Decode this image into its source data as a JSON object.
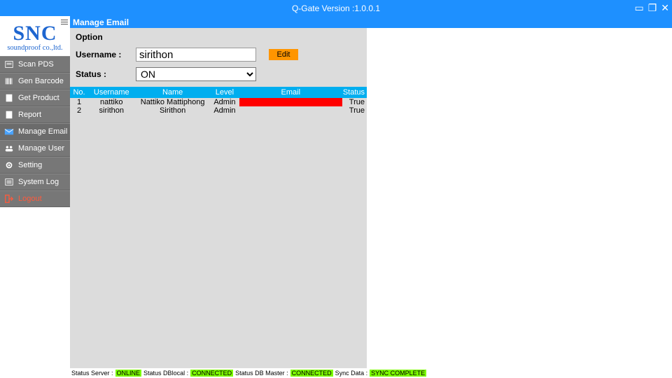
{
  "titlebar": {
    "title": "Q-Gate Version :1.0.0.1"
  },
  "brand": {
    "name": "SNC",
    "sub": "soundproof co.,ltd."
  },
  "sidebar": {
    "items": [
      {
        "label": "Scan PDS"
      },
      {
        "label": "Gen Barcode"
      },
      {
        "label": "Get Product"
      },
      {
        "label": "Report"
      },
      {
        "label": "Manage Email"
      },
      {
        "label": "Manage User"
      },
      {
        "label": "Setting"
      },
      {
        "label": "System Log"
      },
      {
        "label": "Logout"
      }
    ]
  },
  "page": {
    "title": "Manage Email"
  },
  "form": {
    "option_label": "Option",
    "username_label": "Username  :",
    "username_value": "sirithon",
    "status_label": "Status  :",
    "status_value": "ON",
    "edit_label": "Edit"
  },
  "table": {
    "headers": {
      "no": "No.",
      "username": "Username",
      "name": "Name",
      "level": "Level",
      "email": "Email",
      "status": "Status"
    },
    "rows": [
      {
        "no": "1",
        "username": "nattiko",
        "name": "Nattiko Mattiphong",
        "level": "Admin",
        "email": "(redacted)",
        "status": "True",
        "redacted": true
      },
      {
        "no": "2",
        "username": "sirithon",
        "name": "Sirithon",
        "level": "Admin",
        "email": "",
        "status": "True",
        "redacted": false
      }
    ]
  },
  "statusbar": {
    "server_label": "Status Server :",
    "server_value": "ONLINE",
    "dblocal_label": "Status DBlocal :",
    "dblocal_value": "CONNECTED",
    "dbmaster_label": "Status DB Master :",
    "dbmaster_value": "CONNECTED",
    "sync_label": "Sync Data :",
    "sync_value": "SYNC COMPLETE"
  }
}
